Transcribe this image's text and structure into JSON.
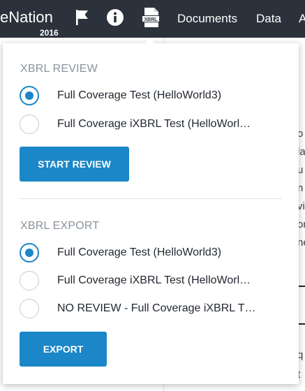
{
  "header": {
    "brand": "eNation",
    "year": "2016",
    "icons": [
      "flag-icon",
      "info-icon",
      "xbrl-file-icon"
    ],
    "nav_links": [
      "Documents",
      "Data",
      "A"
    ]
  },
  "popup": {
    "review": {
      "title": "XBRL REVIEW",
      "options": [
        {
          "label": "Full Coverage Test (HelloWorld3)",
          "selected": true
        },
        {
          "label": "Full Coverage iXBRL Test (HelloWorl…",
          "selected": false
        }
      ],
      "button_label": "START REVIEW"
    },
    "export": {
      "title": "XBRL EXPORT",
      "options": [
        {
          "label": "Full Coverage Test (HelloWorld3)",
          "selected": true
        },
        {
          "label": "Full Coverage iXBRL Test (HelloWorl…",
          "selected": false
        },
        {
          "label": "NO REVIEW - Full Coverage iXBRL T…",
          "selected": false
        }
      ],
      "button_label": "EXPORT"
    }
  },
  "background": {
    "letters": [
      "o",
      "la",
      "u",
      "n",
      "vi",
      "or",
      "ne",
      "q",
      "t"
    ]
  },
  "colors": {
    "topbar": "#2b323b",
    "accent": "#1b86c8",
    "section_title": "#8a929c"
  }
}
